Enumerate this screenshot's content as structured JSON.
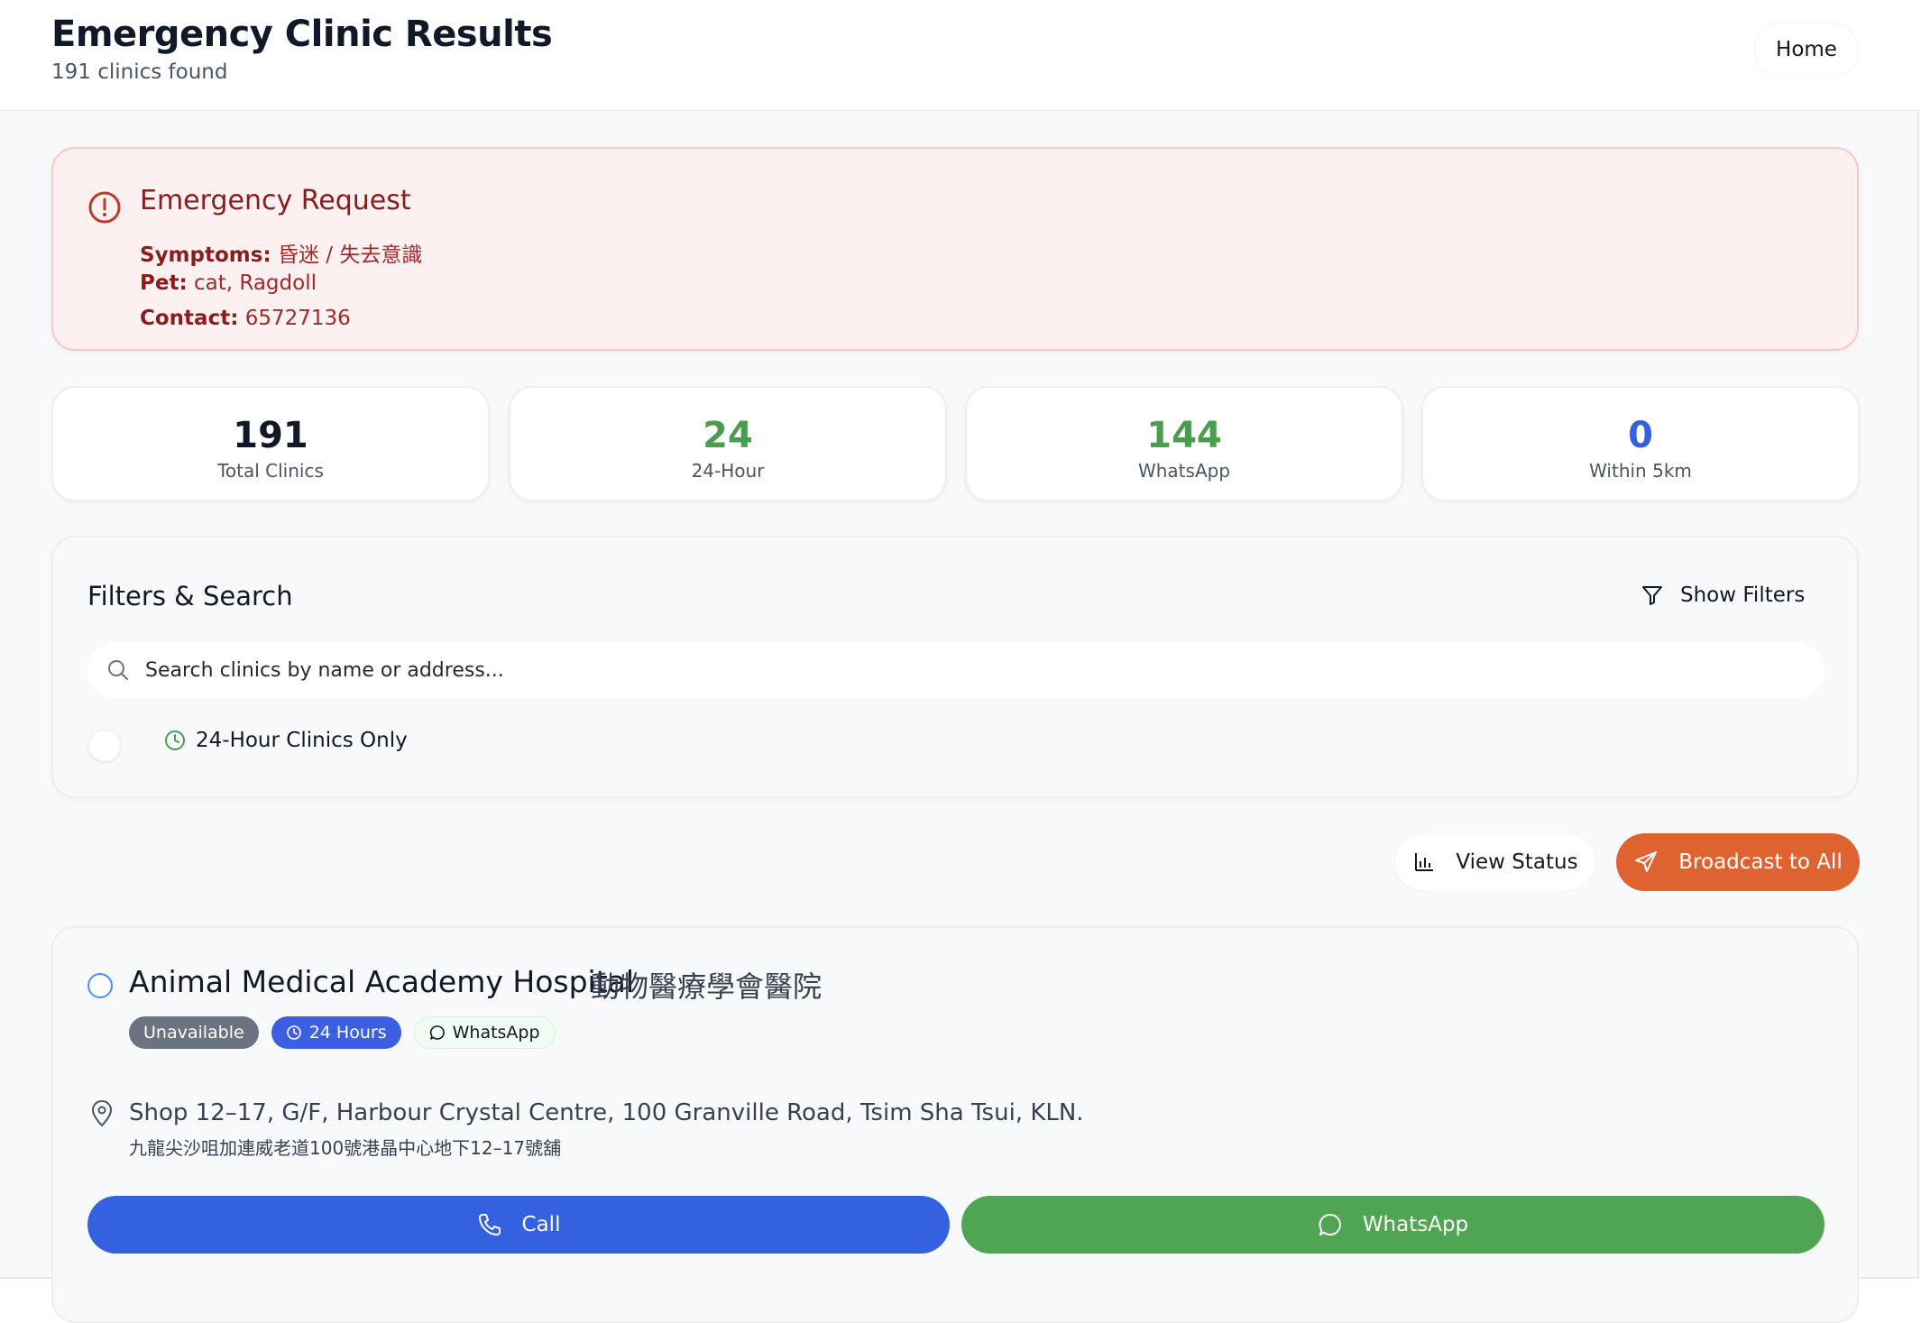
{
  "header": {
    "title": "Emergency Clinic Results",
    "subtitle": "191 clinics found",
    "home_label": "Home"
  },
  "emergency": {
    "title": "Emergency Request",
    "symptoms_label": "Symptoms:",
    "symptoms_value": "昏迷 / 失去意識",
    "pet_label": "Pet:",
    "pet_value": "cat, Ragdoll",
    "contact_label": "Contact:",
    "contact_value": "65727136",
    "icon": "alert-circle-icon"
  },
  "stats": [
    {
      "value": "191",
      "label": "Total Clinics",
      "color": "#111827"
    },
    {
      "value": "24",
      "label": "24-Hour",
      "color": "#4a9d4f"
    },
    {
      "value": "144",
      "label": "WhatsApp",
      "color": "#4a9d4f"
    },
    {
      "value": "0",
      "label": "Within 5km",
      "color": "#3461e0"
    }
  ],
  "filters": {
    "title": "Filters & Search",
    "show_filters_label": "Show Filters",
    "search_placeholder": "Search clinics by name or address...",
    "toggle_label": "24-Hour Clinics Only"
  },
  "actions": {
    "view_status_label": "View Status",
    "broadcast_label": "Broadcast to All"
  },
  "clinic": {
    "name": "Animal Medical Academy Hospital",
    "name_zh": "動物醫療學會醫院",
    "badges": {
      "status": "Unavailable",
      "hours": "24 Hours",
      "whatsapp": "WhatsApp"
    },
    "address": "Shop 12–17, G/F, Harbour Crystal Centre, 100 Granville Road, Tsim Sha Tsui, KLN.",
    "address_zh": "九龍尖沙咀加連威老道100號港晶中心地下12–17號舖",
    "call_label": "Call",
    "whatsapp_label": "WhatsApp"
  },
  "colors": {
    "accent_orange": "#de6331",
    "call_blue": "#3461e0",
    "whatsapp_green": "#4fa551",
    "emergency_bg": "#fdf0f0"
  }
}
